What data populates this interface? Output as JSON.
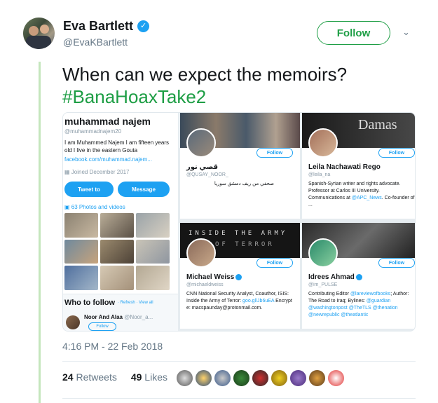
{
  "author": {
    "name": "Eva Bartlett",
    "handle": "@EvaKBartlett",
    "verified": true
  },
  "follow_button_label": "Follow",
  "tweet": {
    "text": "When can we expect the memoirs?",
    "hashtag": "#BanaHoaxTake2"
  },
  "embedded_image": {
    "profile": {
      "name": "muhammad najem",
      "handle": "@muhammadnajem20",
      "bio": "I am Muhammed Najem I am fifteen years old I live in the eastern Gouta",
      "link": "facebook.com/muhammad.najem...",
      "joined": "Joined December 2017",
      "tweet_to": "Tweet to",
      "message": "Message",
      "photos": "63 Photos and videos"
    },
    "who_to_follow": {
      "title": "Who to follow",
      "links": "· Refresh · View all",
      "item_name": "Noor And Alaa",
      "item_handle": "@Noor_a...",
      "follow": "Follow"
    },
    "cards": [
      {
        "name": "قصي نور",
        "handle": "@QUSAY_NOOR_",
        "bio": "صحفي من ريف دمشق سوريا",
        "follow": "Follow"
      },
      {
        "name": "Leila Nachawati Rego",
        "handle": "@leila_na",
        "bio": "Spanish-Syrian writer and rights advocate. Professor at Carlos III University. Communications at",
        "bio_link": "@APC_News",
        "bio_tail": ". Co-founder of ...",
        "banner_text": "Damas",
        "follow": "Follow"
      },
      {
        "name": "Michael Weiss",
        "handle": "@michaeldweiss",
        "bio": "CNN National Security Analyst, Coauthor, ISIS: Inside the Army of Terror:",
        "bio_link": "goo.gl/Jb6uEA",
        "bio_tail": " Encrypt e: macspaunday@protonmail.com.",
        "banner_line1": "INSIDE THE ARMY",
        "banner_line2": "OF TERROR",
        "follow": "Follow"
      },
      {
        "name": "Idrees Ahmad",
        "handle": "@im_PULSE",
        "bio": "Contributing Editor",
        "bio_link": "@lareviewofbooks",
        "bio_tail": "; Author: The Road to Iraq; Bylines:",
        "bio_links2": "@guardian @washingtonpost @TheTLS @thenation @newrepublic @theatlantic",
        "follow": "Follow"
      }
    ]
  },
  "timestamp": "4:16 PM - 22 Feb 2018",
  "stats": {
    "retweets_count": "24",
    "retweets_label": "Retweets",
    "likes_count": "49",
    "likes_label": "Likes"
  },
  "colors": {
    "accent": "#1e9e45",
    "link": "#1da1f2",
    "thread_line": "#c4e6bd"
  }
}
